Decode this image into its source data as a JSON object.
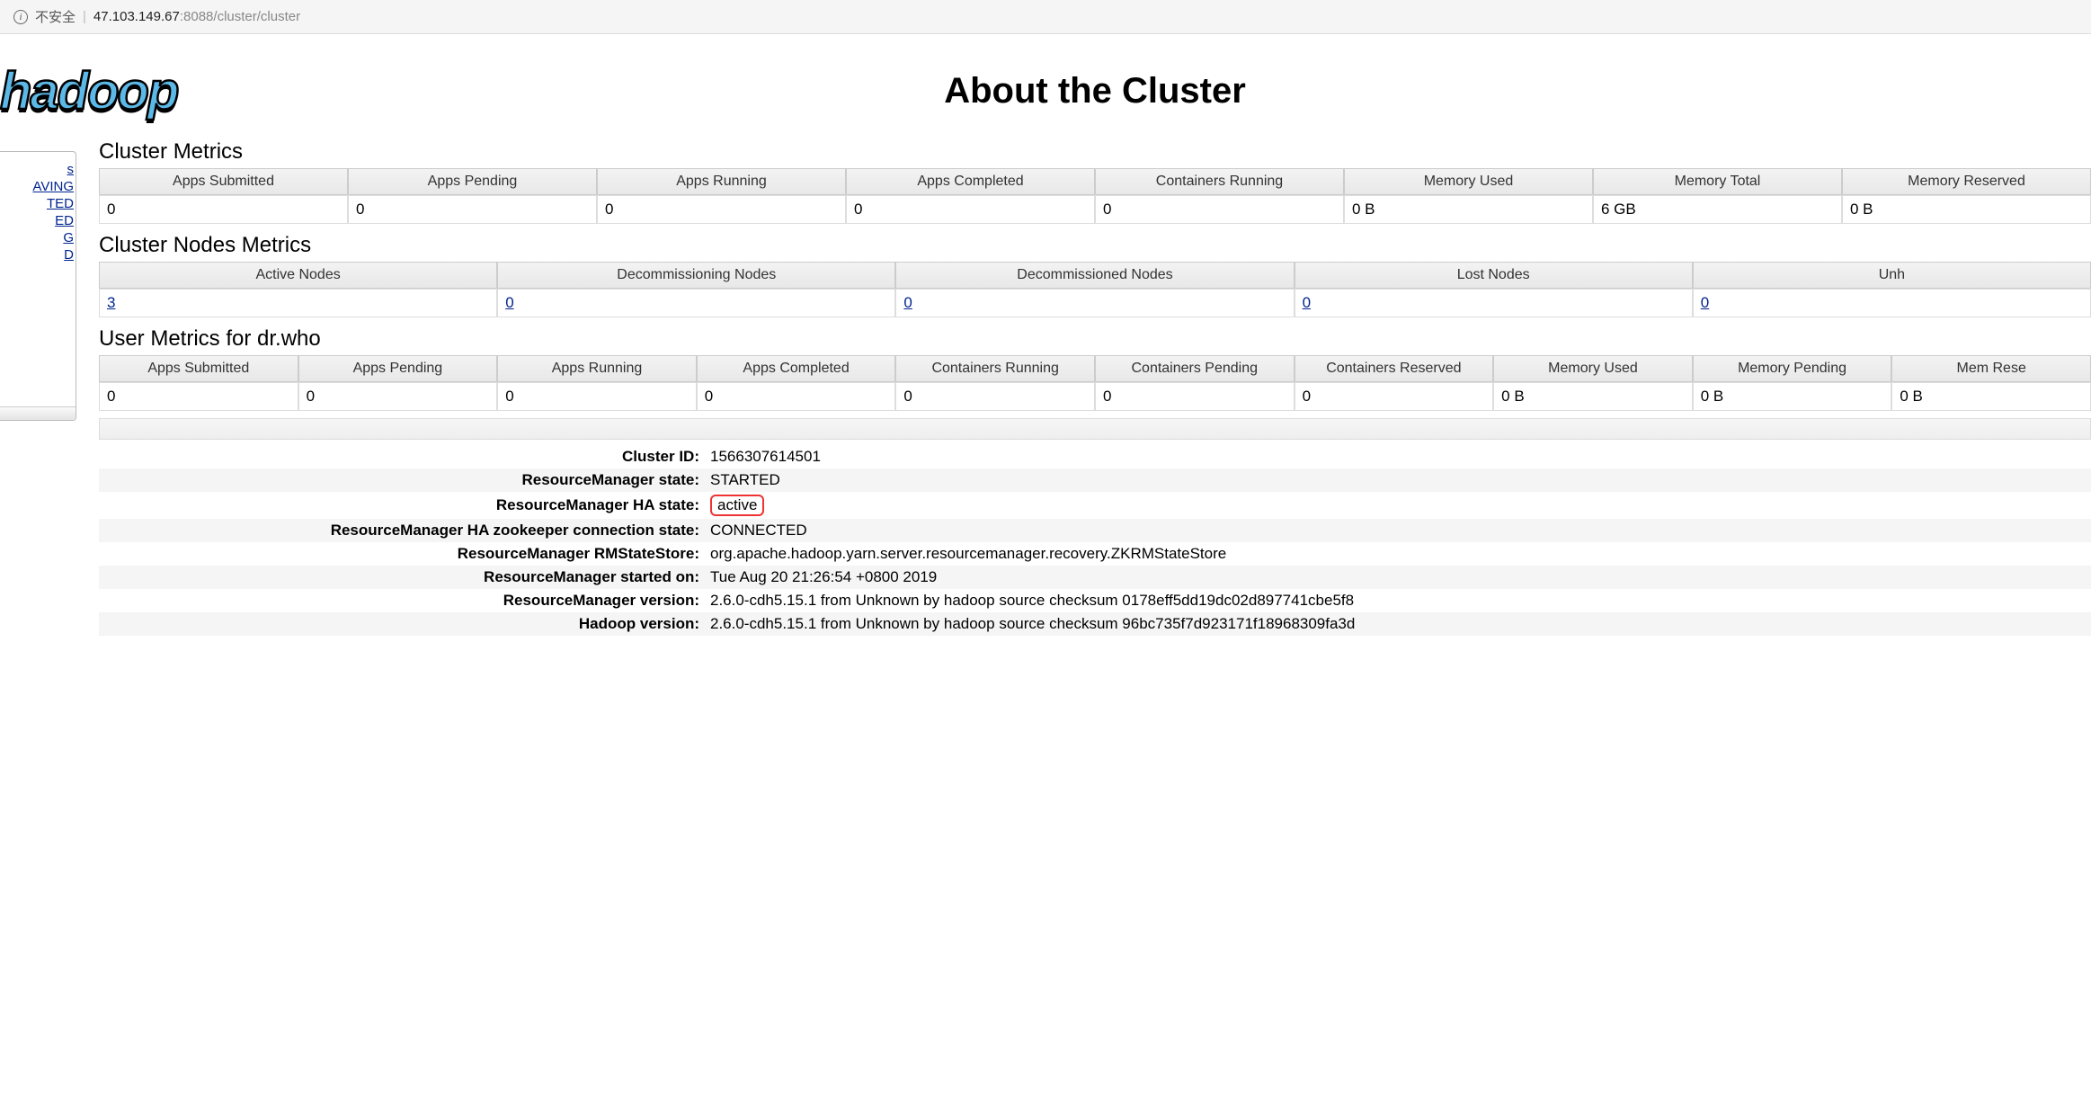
{
  "browser": {
    "insecure_label": "不安全",
    "host": "47.103.149.67",
    "port_path": ":8088/cluster/cluster"
  },
  "logo_text": "hadoop",
  "page_title": "About the Cluster",
  "sidebar": {
    "items": [
      "s",
      "AVING",
      "TED",
      "ED",
      "G",
      "D"
    ]
  },
  "cluster_metrics": {
    "title": "Cluster Metrics",
    "headers": [
      "Apps Submitted",
      "Apps Pending",
      "Apps Running",
      "Apps Completed",
      "Containers Running",
      "Memory Used",
      "Memory Total",
      "Memory Reserved"
    ],
    "values": [
      "0",
      "0",
      "0",
      "0",
      "0",
      "0 B",
      "6 GB",
      "0 B"
    ]
  },
  "nodes_metrics": {
    "title": "Cluster Nodes Metrics",
    "headers": [
      "Active Nodes",
      "Decommissioning Nodes",
      "Decommissioned Nodes",
      "Lost Nodes",
      "Unh"
    ],
    "values": [
      "3",
      "0",
      "0",
      "0",
      "0"
    ]
  },
  "user_metrics": {
    "title": "User Metrics for dr.who",
    "headers": [
      "Apps Submitted",
      "Apps Pending",
      "Apps Running",
      "Apps Completed",
      "Containers Running",
      "Containers Pending",
      "Containers Reserved",
      "Memory Used",
      "Memory Pending",
      "Mem Rese"
    ],
    "values": [
      "0",
      "0",
      "0",
      "0",
      "0",
      "0",
      "0",
      "0 B",
      "0 B",
      "0 B"
    ]
  },
  "details": [
    {
      "label": "Cluster ID:",
      "value": "1566307614501",
      "highlight": false
    },
    {
      "label": "ResourceManager state:",
      "value": "STARTED",
      "highlight": false
    },
    {
      "label": "ResourceManager HA state:",
      "value": "active",
      "highlight": true
    },
    {
      "label": "ResourceManager HA zookeeper connection state:",
      "value": "CONNECTED",
      "highlight": false
    },
    {
      "label": "ResourceManager RMStateStore:",
      "value": "org.apache.hadoop.yarn.server.resourcemanager.recovery.ZKRMStateStore",
      "highlight": false
    },
    {
      "label": "ResourceManager started on:",
      "value": "Tue Aug 20 21:26:54 +0800 2019",
      "highlight": false
    },
    {
      "label": "ResourceManager version:",
      "value": "2.6.0-cdh5.15.1 from Unknown by hadoop source checksum 0178eff5dd19dc02d897741cbe5f8",
      "highlight": false
    },
    {
      "label": "Hadoop version:",
      "value": "2.6.0-cdh5.15.1 from Unknown by hadoop source checksum 96bc735f7d923171f18968309fa3d",
      "highlight": false
    }
  ]
}
